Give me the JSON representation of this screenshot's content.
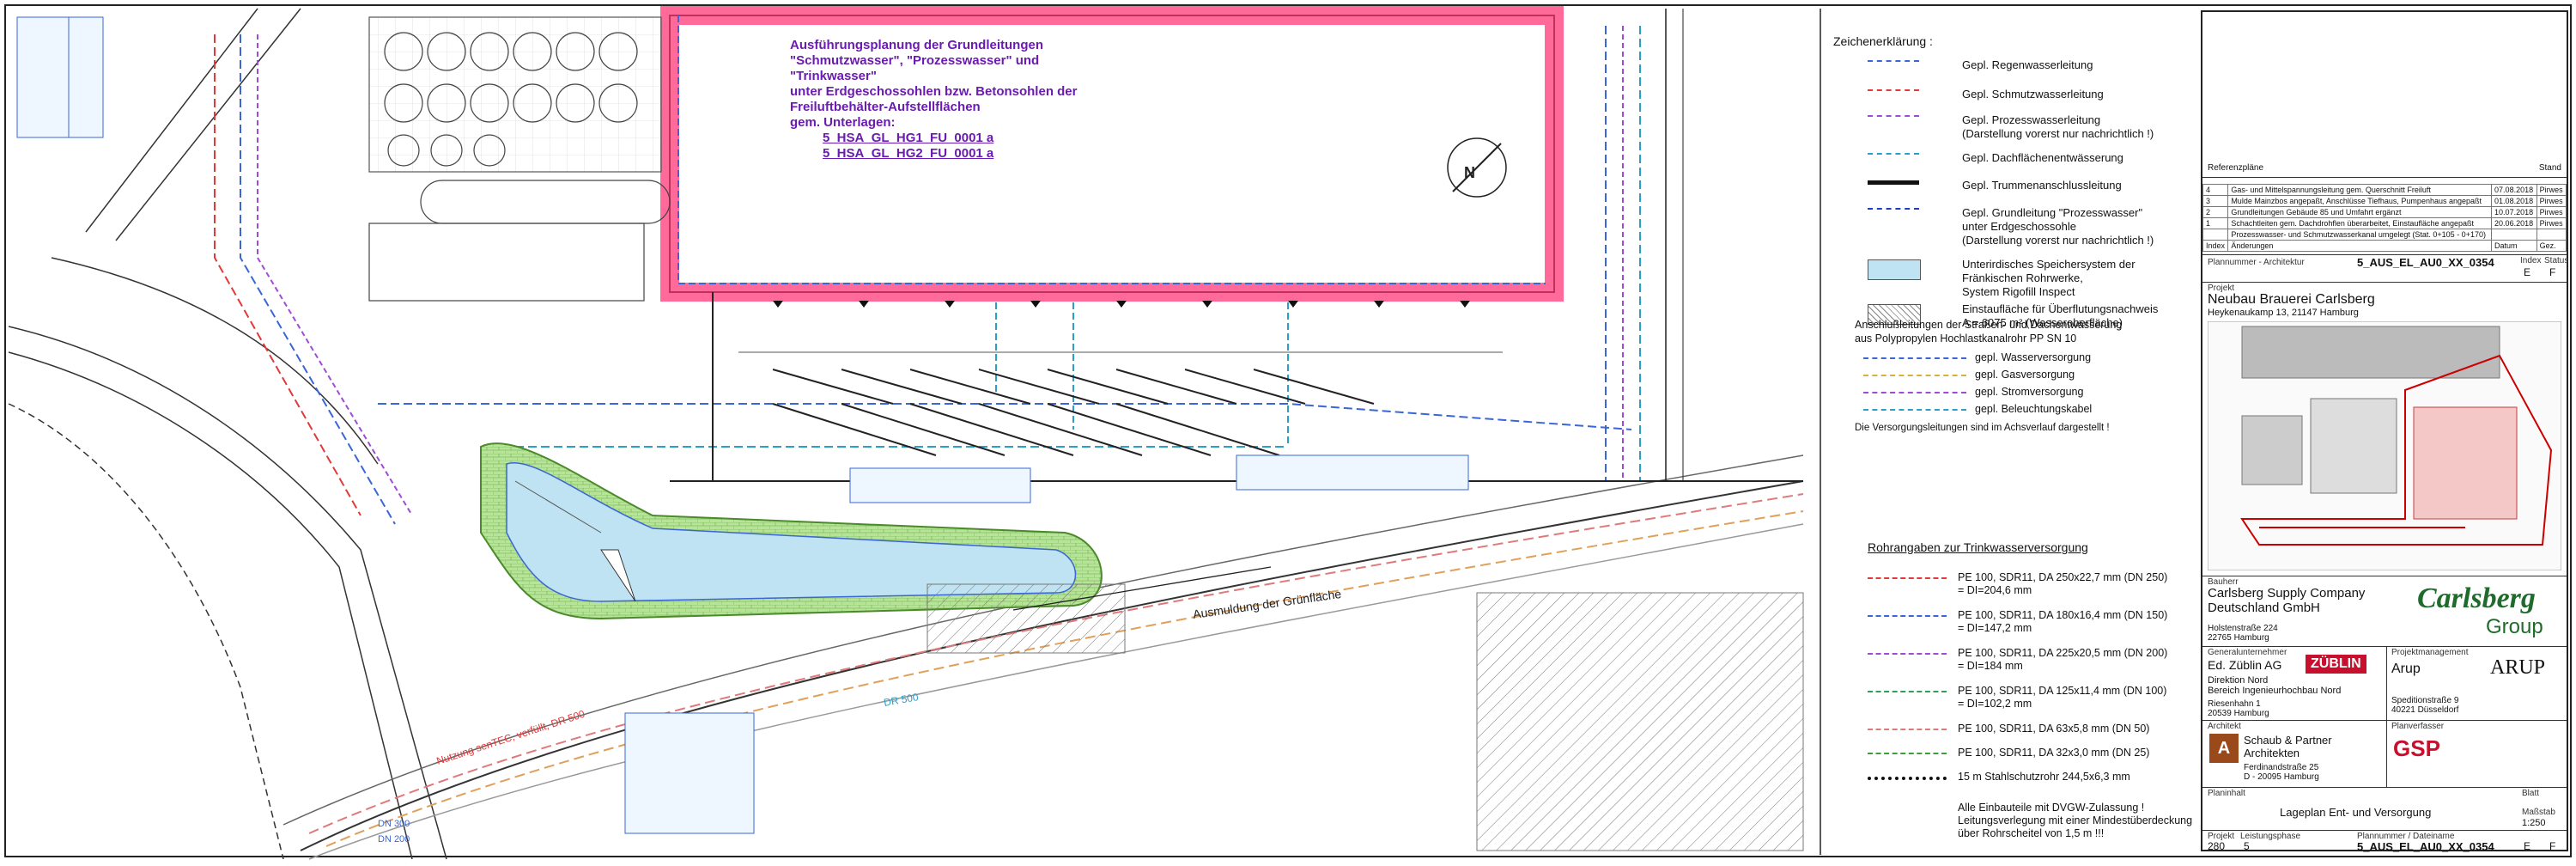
{
  "drawing": {
    "purple_note": {
      "lines": [
        "Ausführungsplanung der Grundleitungen",
        "\"Schmutzwasser\", \"Prozesswasser\" und \"Trinkwasser\"",
        "unter Erdgeschossohlen bzw. Betonsohlen der",
        "Freiluftbehälter-Aufstellflächen",
        "gem. Unterlagen:"
      ],
      "docs": [
        "5_HSA_GL_HG1_FU_0001 a",
        "5_HSA_GL_HG2_FU_0001 a"
      ]
    },
    "street_labels": [
      "Ausmuldung der Grünfläche",
      "DN 300",
      "DN 200",
      "DR 500",
      "Nutzung senTEC, verfüllt, DR 500"
    ],
    "north_arrow": "N"
  },
  "legend": {
    "title": "Zeichenerklärung :",
    "items": [
      {
        "label": "Gepl. Regenwasserleitung",
        "color": "#3a66d6"
      },
      {
        "label": "Gepl. Schmutzwasserleitung",
        "color": "#e03a3a"
      },
      {
        "label": "Gepl. Prozesswasserleitung\n(Darstellung vorerst nur nachrichtlich !)",
        "color": "#a04bd6"
      },
      {
        "label": "Gepl. Dachflächenentwässerung",
        "color": "#2aa0c8"
      },
      {
        "label": "Gepl. Trummenanschlussleitung",
        "color": "#111111"
      },
      {
        "label": "Gepl. Grundleitung \"Prozesswasser\"\nunter Erdgeschossohle\n(Darstellung vorerst nur nachrichtlich !)",
        "color": "#1a3fbf"
      },
      {
        "label": "Unterirdisches Speichersystem der\nFränkischen Rohrwerke,\nSystem Rigofill Inspect",
        "color": "#bfe3f2"
      },
      {
        "label": "Einstaufläche für Überflutungsnachweis\nA = 6075 m² (Wasseroberfläche)",
        "color": "#888888"
      }
    ]
  },
  "connections": {
    "title": "Anschlußleitungen der Straßen- und Dachentwässerung\naus Polypropylen Hochlastkanalrohr PP SN 10",
    "items": [
      {
        "label": "gepl. Wasserversorgung",
        "color": "#3a66d6"
      },
      {
        "label": "gepl. Gasversorgung",
        "color": "#d6b23a"
      },
      {
        "label": "gepl. Stromversorgung",
        "color": "#a04bd6"
      },
      {
        "label": "gepl. Beleuchtungskabel",
        "color": "#2aa0c8"
      }
    ],
    "footnote": "Die Versorgungsleitungen sind im Achsverlauf dargestellt !"
  },
  "pipes": {
    "title": "Rohrangaben zur Trinkwasserversorgung",
    "items": [
      {
        "label": "PE 100, SDR11, DA 250x22,7 mm (DN 250)\n= DI=204,6 mm",
        "color": "#e03a3a"
      },
      {
        "label": "PE 100, SDR11, DA 180x16,4 mm (DN 150)\n= DI=147,2 mm",
        "color": "#3a66d6"
      },
      {
        "label": "PE 100, SDR11, DA 225x20,5 mm (DN 200)\n= DI=184 mm",
        "color": "#a04bd6"
      },
      {
        "label": "PE 100, SDR11, DA 125x11,4 mm (DN 100)\n= DI=102,2 mm",
        "color": "#2aa05a"
      },
      {
        "label": "PE 100, SDR11, DA 63x5,8 mm (DN 50)",
        "color": "#e07a7a"
      },
      {
        "label": "PE 100, SDR11, DA 32x3,0 mm (DN 25)",
        "color": "#3aa03a"
      },
      {
        "label": "15 m Stahlschutzrohr 244,5x6,3 mm",
        "color": "#111111"
      }
    ],
    "footer": "Alle Einbauteile mit DVGW-Zulassung !\nLeitungsverlegung mit einer Mindestüberdeckung\nüber Rohrscheitel von 1,5 m !!!"
  },
  "title_block": {
    "ref_plans_label": "Referenzpläne",
    "stand_label": "Stand",
    "revisions": [
      {
        "no": "4",
        "text": "Gas- und Mittelspannungsleitung gem. Querschnitt Freiluft",
        "date": "07.08.2018",
        "by": "Pirwes"
      },
      {
        "no": "3",
        "text": "Mulde Mainzbos angepaßt, Anschlüsse Tiefhaus, Pumpenhaus angepaßt",
        "date": "01.08.2018",
        "by": "Pirwes"
      },
      {
        "no": "2",
        "text": "Grundleitungen Gebäude 85 und Umfahrt ergänzt",
        "date": "10.07.2018",
        "by": "Pirwes"
      },
      {
        "no": "1",
        "text": "Schachtleiten gem. Dachdrohflen überarbeitet, Einstaufläche angepaßt",
        "date": "20.06.2018",
        "by": "Pirwes"
      },
      {
        "no": "",
        "text": "Prozesswasser- und Schmutzwasserkanal umgelegt (Stat. 0+105 - 0+170)",
        "date": "",
        "by": ""
      }
    ],
    "rev_header": {
      "no": "Index",
      "text": "Änderungen",
      "date": "Datum",
      "by": "Gez."
    },
    "plan_no_label": "Plannummer - Architektur",
    "plan_no": "5_AUS_EL_AU0_XX_0354",
    "index_label": "Index",
    "index": "E",
    "status_label": "Status",
    "status": "F",
    "project_label": "Projekt",
    "project": "Neubau Brauerei Carlsberg",
    "address": "Heykenaukamp 13, 21147 Hamburg",
    "owner_label": "Bauherr",
    "owner": "Carlsberg Supply Company\nDeutschland GmbH",
    "owner_addr": "Holstenstraße 224\n22765 Hamburg",
    "carlsberg_logo": "Carlsberg",
    "carlsberg_group": "Group",
    "gc_label": "Generalunternehmer",
    "gc": "Ed. Züblin AG",
    "gc_sub": "Direktion Nord\nBereich Ingenieurhochbau Nord",
    "gc_addr": "Riesenhahn 1\n20539 Hamburg",
    "zublin_logo": "ZÜBLIN",
    "pm_label": "Projektmanagement",
    "pm": "Arup",
    "pm_addr": "Speditionstraße 9\n40221 Düsseldorf",
    "arup_logo": "ARUP",
    "arch_label": "Architekt",
    "arch": "Schaub & Partner\nArchitekten",
    "arch_addr": "Ferdinandstraße 25\nD - 20095 Hamburg",
    "planner_label": "Planverfasser",
    "gsp_logo": "GSP",
    "planinhalt_label": "Planinhalt",
    "planinhalt": "Lageplan Ent- und Versorgung",
    "massstab_label": "Maßstab",
    "massstab": "1:250",
    "projekt_no_label": "Projekt",
    "projekt_no": "280",
    "phase_label": "Leistungsphase",
    "phase": "5",
    "dateiname_label": "Plannummer / Dateiname",
    "blatt_label": "Blatt"
  }
}
